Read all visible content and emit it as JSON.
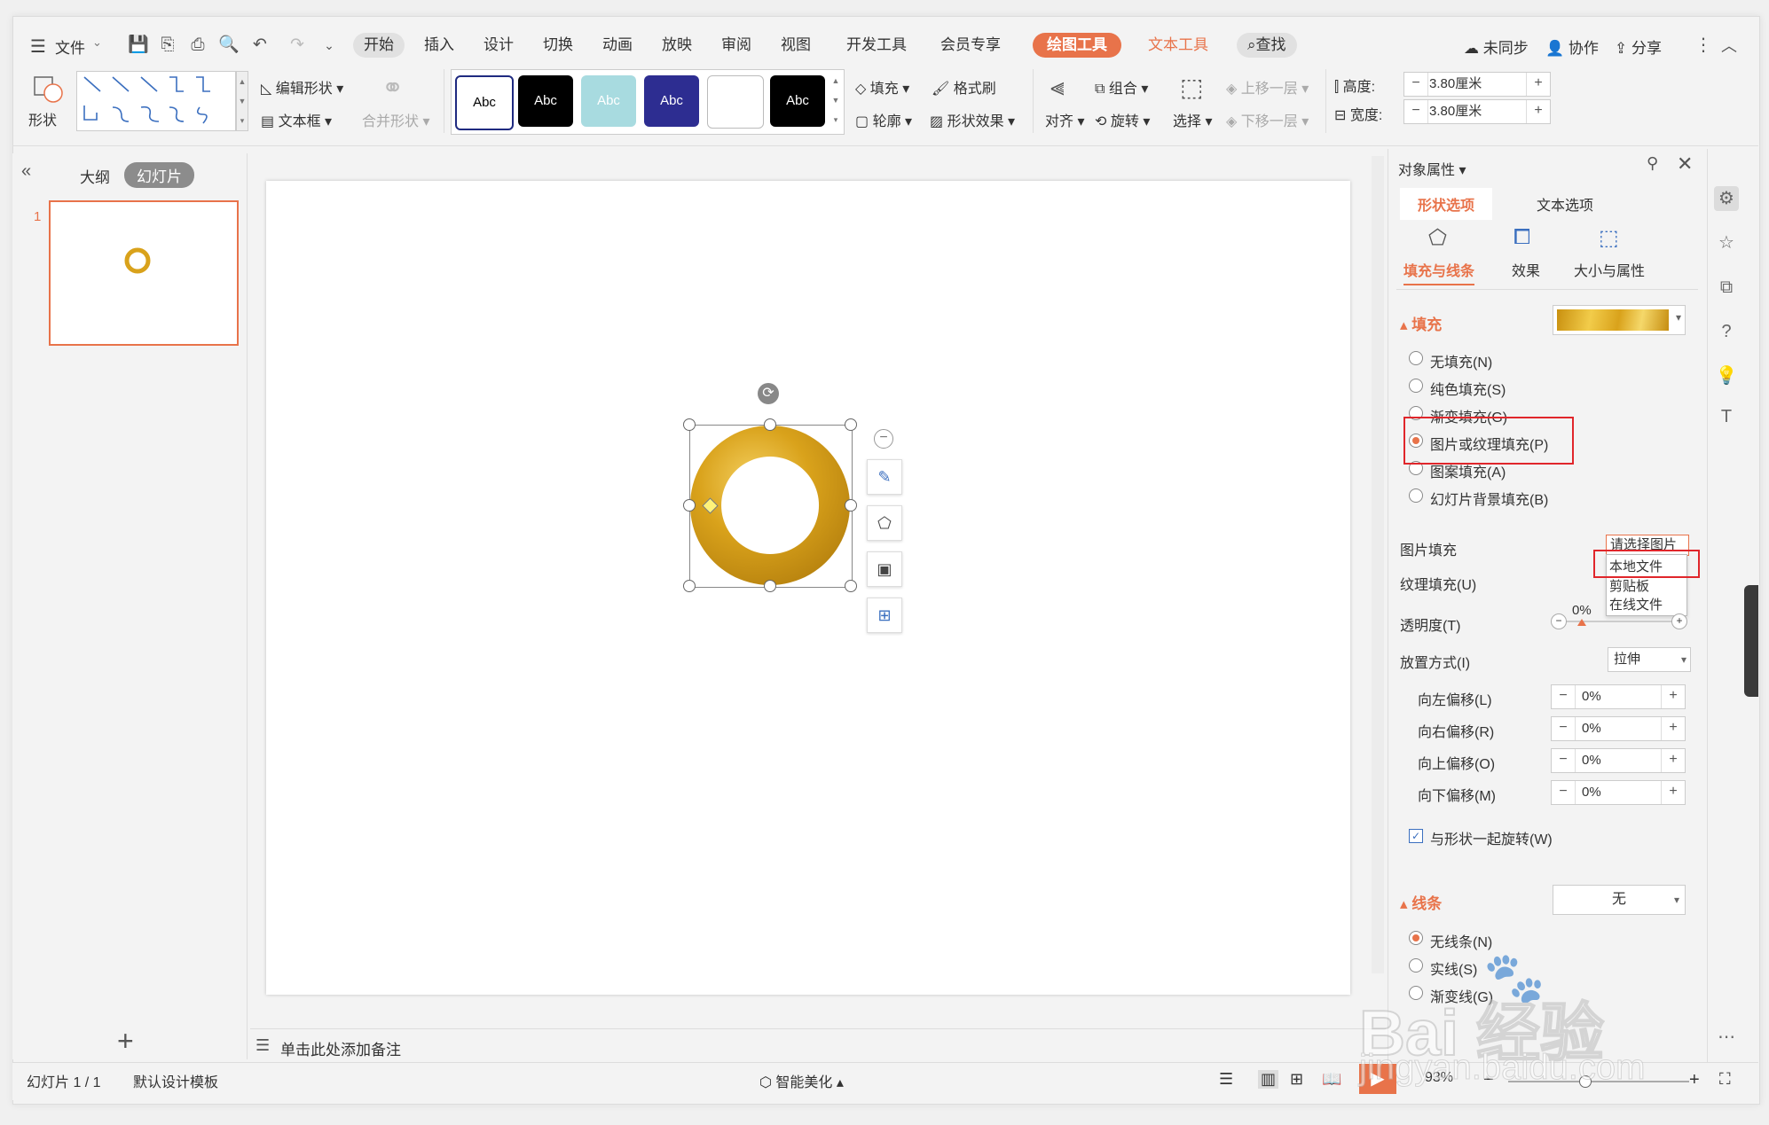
{
  "menu": {
    "file": "文件",
    "tabs": [
      "开始",
      "插入",
      "设计",
      "切换",
      "动画",
      "放映",
      "审阅",
      "视图",
      "开发工具",
      "会员专享"
    ],
    "draw_tool": "绘图工具",
    "text_tool": "文本工具",
    "search": "查找",
    "sync": "未同步",
    "collab": "协作",
    "share": "分享"
  },
  "ribbon": {
    "shape": "形状",
    "edit_shape": "编辑形状",
    "text_box": "文本框",
    "merge_shape": "合并形状",
    "style_label": "Abc",
    "fill": "填充",
    "format_brush": "格式刷",
    "outline": "轮廓",
    "shape_effect": "形状效果",
    "align": "对齐",
    "group": "组合",
    "rotate": "旋转",
    "select": "选择",
    "move_up": "上移一层",
    "move_down": "下移一层",
    "height_label": "高度:",
    "height_value": "3.80厘米",
    "width_label": "宽度:",
    "width_value": "3.80厘米"
  },
  "left_panel": {
    "outline_tab": "大纲",
    "slides_tab": "幻灯片",
    "slide_number": "1"
  },
  "notes_placeholder": "单击此处添加备注",
  "right_panel": {
    "title": "对象属性",
    "tab_shape": "形状选项",
    "tab_text": "文本选项",
    "sub_fill_line": "填充与线条",
    "sub_effect": "效果",
    "sub_size": "大小与属性",
    "fill_section": "填充",
    "fill_options": [
      "无填充(N)",
      "纯色填充(S)",
      "渐变填充(G)",
      "图片或纹理填充(P)",
      "图案填充(A)",
      "幻灯片背景填充(B)"
    ],
    "picture_fill_label": "图片填充",
    "picture_fill_select": "请选择图片",
    "dropdown_options": [
      "本地文件",
      "剪贴板",
      "在线文件"
    ],
    "texture_fill_label": "纹理填充(U)",
    "transparency_label": "透明度(T)",
    "transparency_value": "0%",
    "placement_label": "放置方式(I)",
    "placement_value": "拉伸",
    "offsets": [
      {
        "label": "向左偏移(L)",
        "value": "0%"
      },
      {
        "label": "向右偏移(R)",
        "value": "0%"
      },
      {
        "label": "向上偏移(O)",
        "value": "0%"
      },
      {
        "label": "向下偏移(M)",
        "value": "0%"
      }
    ],
    "rotate_with_shape": "与形状一起旋转(W)",
    "line_section": "线条",
    "line_value": "无",
    "line_options": [
      "无线条(N)",
      "实线(S)",
      "渐变线(G)"
    ]
  },
  "status": {
    "slide_info": "幻灯片 1 / 1",
    "template": "默认设计模板",
    "smart_beautify": "智能美化",
    "zoom": "93%"
  },
  "watermark": {
    "brand": "Bai 经验",
    "url": "jingyan.baidu.com"
  },
  "colors": {
    "accent": "#e8734a",
    "highlight_box": "#e0262b",
    "gold": "#d9a21b"
  }
}
